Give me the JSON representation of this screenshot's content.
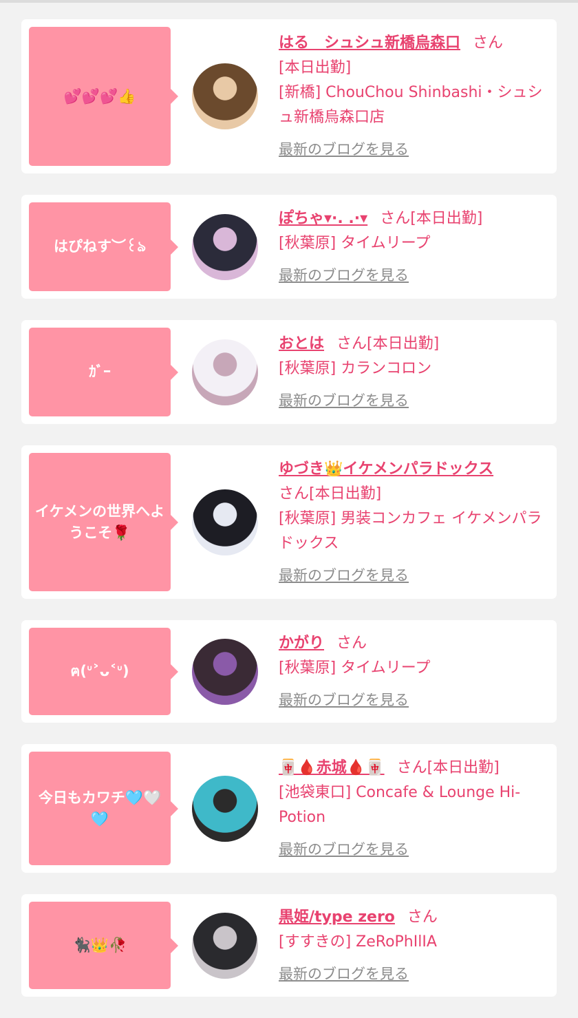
{
  "cards": [
    {
      "bubble": "💕💕💕👍",
      "avatar": {
        "icon": "avatar-photo",
        "colors": [
          "#6b4a2d",
          "#e8c9a6"
        ]
      },
      "name": "はる　シュシュ新橋烏森口",
      "san": "さん",
      "status": "[本日出勤]",
      "shop": "[新橋] ChouChou Shinbashi・シュシュ新橋烏森口店",
      "blog": "最新のブログを見る"
    },
    {
      "bubble": "はぴねす︶꒰ঌ",
      "avatar": {
        "icon": "avatar-photo",
        "colors": [
          "#2b2b3a",
          "#d9b7d8"
        ]
      },
      "name": "ぽちゃ▾·. .·▾",
      "san": "さん",
      "status": "[本日出勤]",
      "shop": "[秋葉原] タイムリープ",
      "blog": "最新のブログを見る"
    },
    {
      "bubble": "ｶﾞｰ",
      "avatar": {
        "icon": "avatar-photo",
        "colors": [
          "#f3f0f6",
          "#c7a7b8"
        ]
      },
      "name": "おとは",
      "san": "さん",
      "status": "[本日出勤]",
      "shop": "[秋葉原] カランコロン",
      "blog": "最新のブログを見る"
    },
    {
      "bubble": "イケメンの世界へようこそ🌹",
      "avatar": {
        "icon": "avatar-photo",
        "colors": [
          "#1d1d24",
          "#e6e9f2"
        ]
      },
      "name": "ゆづき👑イケメンパラドックス",
      "san": "さん",
      "status": "[本日出勤]",
      "shop": "[秋葉原] 男装コンカフェ イケメンパラドックス",
      "blog": "最新のブログを見る"
    },
    {
      "bubble": "ฅ(ᐡ˃ᴗ˂ᐡ)",
      "avatar": {
        "icon": "avatar-photo",
        "colors": [
          "#3a2a35",
          "#8a5aa8"
        ]
      },
      "name": "かがり",
      "san": "さん",
      "status": "",
      "shop": "[秋葉原] タイムリープ",
      "blog": "最新のブログを見る"
    },
    {
      "bubble": "今日もカワチ🩵🤍🩵",
      "avatar": {
        "icon": "avatar-photo",
        "colors": [
          "#3fb9c9",
          "#2b2b2b"
        ]
      },
      "name": "🀄🩸赤城🩸🀄",
      "san": "さん",
      "status": "[本日出勤]",
      "shop": "[池袋東口] Concafe & Lounge Hi-Potion",
      "blog": "最新のブログを見る"
    },
    {
      "bubble": "🐈‍⬛👑🥀",
      "avatar": {
        "icon": "avatar-photo",
        "colors": [
          "#2a2a2e",
          "#c9c4c9"
        ]
      },
      "name": "黒姫/type zero",
      "san": "さん",
      "status": "",
      "shop": "[すすきの] ZeRoPhIlIA",
      "blog": "最新のブログを見る"
    }
  ]
}
